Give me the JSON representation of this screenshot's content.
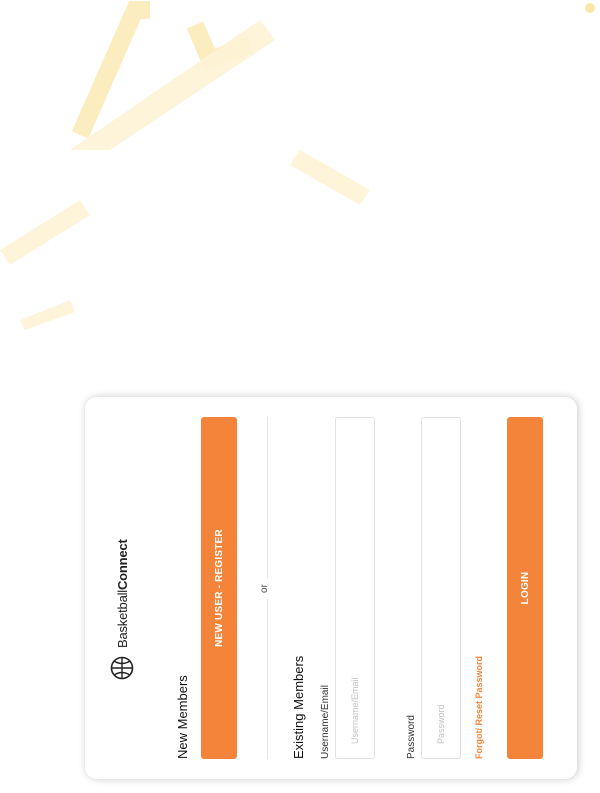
{
  "brand": {
    "name_light": "Basketball",
    "name_bold": "Connect"
  },
  "new_members": {
    "title": "New Members",
    "register_label": "NEW USER - REGISTER"
  },
  "divider": {
    "text": "or"
  },
  "existing_members": {
    "title": "Existing Members",
    "username_label": "Username/Email",
    "username_placeholder": "Username/Email",
    "password_label": "Password",
    "password_placeholder": "Password",
    "forgot_label": "Forgot/ Reset Password",
    "login_label": "LOGIN"
  },
  "colors": {
    "accent": "#f5843b",
    "watermark": "#fbe7a6"
  }
}
